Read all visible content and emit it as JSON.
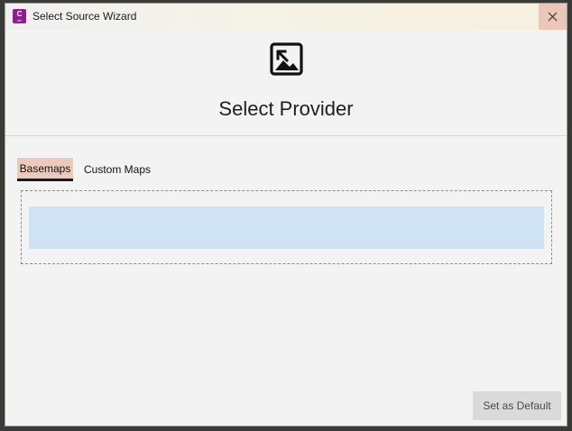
{
  "window": {
    "title": "Select Source Wizard",
    "app_icon_letter": "C",
    "app_icon_sub": "civ"
  },
  "header": {
    "title": "Select Provider",
    "icon": "image-icon"
  },
  "tabs": [
    {
      "label": "Basemaps",
      "active": true
    },
    {
      "label": "Custom Maps",
      "active": false
    }
  ],
  "footer": {
    "default_button_label": "Set as Default"
  },
  "colors": {
    "close_button_bg": "#ecc6b9",
    "active_tab_bg": "#ebc9bd",
    "selection_bg": "#cfe3f4",
    "app_icon_bg": "#8b1f8e"
  }
}
